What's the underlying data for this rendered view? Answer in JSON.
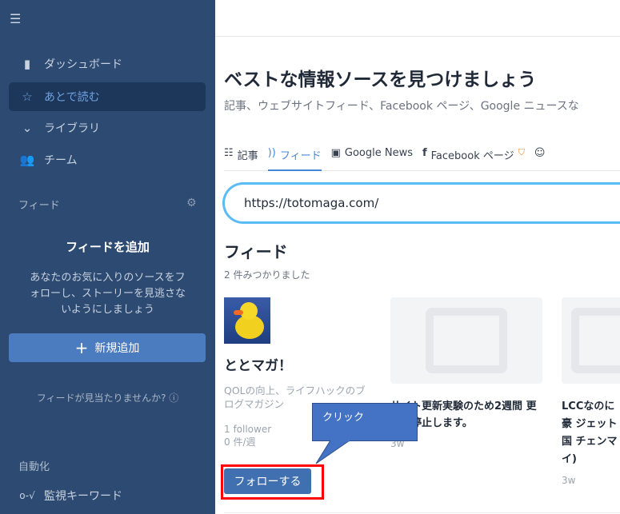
{
  "sidebar": {
    "menu_icon": "hamburger-icon",
    "items": [
      {
        "label": "ダッシュボード",
        "icon": "bar-chart-icon"
      },
      {
        "label": "あとで読む",
        "icon": "star-icon",
        "active": true
      },
      {
        "label": "ライブラリ",
        "icon": "chevron-circle-icon"
      },
      {
        "label": "チーム",
        "icon": "users-icon"
      }
    ],
    "feed_section": "フィード",
    "add_feed_title": "フィードを追加",
    "add_feed_desc": "あなたのお気に入りのソースをフォローし、ストーリーを見逃さないようにしましょう",
    "add_button": "新規追加",
    "missing": "フィードが見当たりませんか?",
    "automation_section": "自動化",
    "keyword_item": "監視キーワード"
  },
  "main": {
    "title": "ベストな情報ソースを見つけましょう",
    "subtitle": "記事、ウェブサイトフィード、Facebook ページ、Google ニュースな",
    "tabs": [
      {
        "label": "記事"
      },
      {
        "label": "フィード"
      },
      {
        "label": "Google News"
      },
      {
        "label": "Facebook ページ"
      }
    ],
    "search_value": "https://totomaga.com/",
    "feeds_heading": "フィード",
    "found_count": "2 件みつかりました",
    "feed": {
      "name": "ととマガ！",
      "desc": "QOLの向上、ライフハックのブログマガジン",
      "followers": "1 follower",
      "rate": "0 件/週",
      "follow_button": "フォローする"
    },
    "articles": [
      {
        "title": "サイト更新実験のため2週間 更新を停止します。",
        "age": "3w"
      },
      {
        "title": "LCCなのに豪 ジェット国 チェンマイ)",
        "age": "3w"
      }
    ],
    "callout": "クリック"
  },
  "colors": {
    "sidebar": "#2c4a72",
    "accent": "#4a86d8",
    "follow": "#4170b0",
    "highlight": "#ff0000",
    "callout": "#4472c4"
  }
}
